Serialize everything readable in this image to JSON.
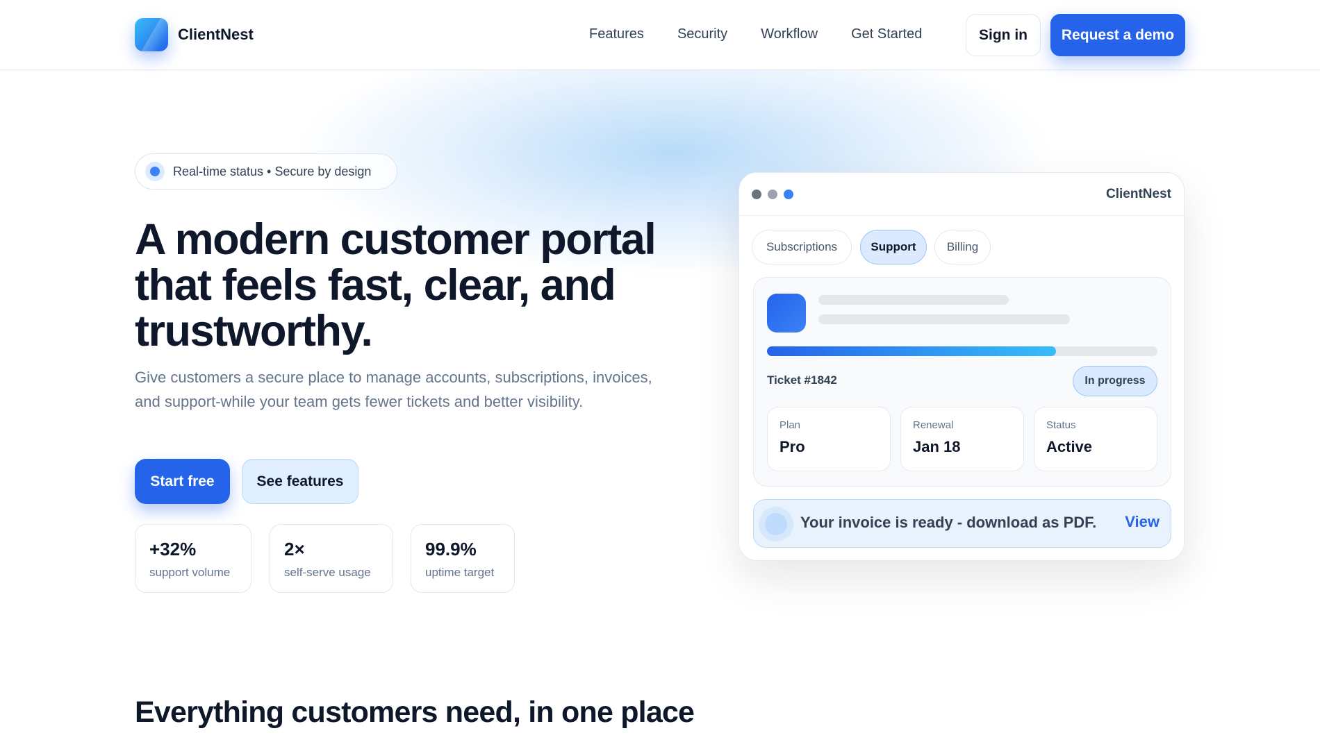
{
  "header": {
    "brand": "ClientNest",
    "nav": [
      "Features",
      "Security",
      "Workflow",
      "Get Started"
    ],
    "signin_label": "Sign in",
    "demo_label": "Request a demo"
  },
  "hero": {
    "pill_text": "Real-time status • Secure by design",
    "headline_lines": [
      "A modern customer portal",
      "that feels fast, clear, and",
      "trustworthy."
    ],
    "lede": "Give customers a secure place to manage accounts, subscriptions, invoices, and support-while your team gets fewer tickets and better visibility.",
    "start_label": "Start free",
    "features_label": "See features",
    "stats": [
      {
        "value": "+32%",
        "label": "support volume"
      },
      {
        "value": "2×",
        "label": "self-serve usage"
      },
      {
        "value": "99.9%",
        "label": "uptime target"
      }
    ]
  },
  "mock": {
    "window_title": "ClientNest",
    "tabs": [
      "Subscriptions",
      "Support",
      "Billing"
    ],
    "active_tab": "Support",
    "progress": 0.74,
    "ticket_label": "Ticket #1842",
    "status": "In progress",
    "tiles": [
      {
        "label": "Plan",
        "value": "Pro"
      },
      {
        "label": "Renewal",
        "value": "Jan 18"
      },
      {
        "label": "Status",
        "value": "Active"
      }
    ],
    "notice_text": "Your invoice is ready - download as PDF.",
    "notice_action": "View"
  },
  "section": {
    "title": "Everything customers need, in one place"
  },
  "colors": {
    "accent": "#2563eb",
    "accent_light": "#dbeafe",
    "text": "#0f172a",
    "muted": "#64748b"
  },
  "icons": {
    "logo": "brand-logo-icon",
    "pill": "status-dot-icon",
    "notice": "info-dot-icon"
  }
}
